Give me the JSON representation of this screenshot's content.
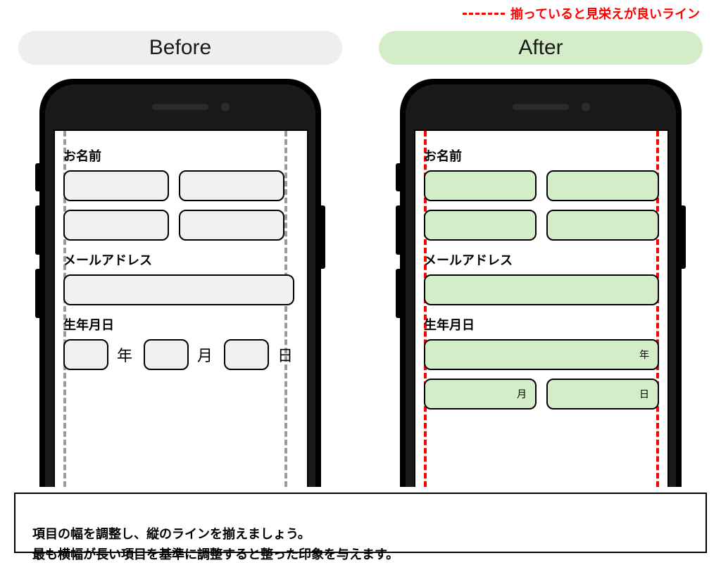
{
  "legend": {
    "text": "揃っていると見栄えが良いライン"
  },
  "headers": {
    "before": "Before",
    "after": "After"
  },
  "labels": {
    "name": "お名前",
    "email": "メールアドレス",
    "dob": "生年月日"
  },
  "suffix": {
    "year": "年",
    "month": "月",
    "day": "日"
  },
  "caption": "項目の幅を調整し、縦のラインを揃えましょう。\n最も横幅が長い項目を基準に調整すると整った印象を与えます。",
  "colors": {
    "accent_before": "#eeeeee",
    "accent_after": "#d4edc9",
    "guide_before": "#9a9a9a",
    "guide_after": "#ff0000"
  }
}
